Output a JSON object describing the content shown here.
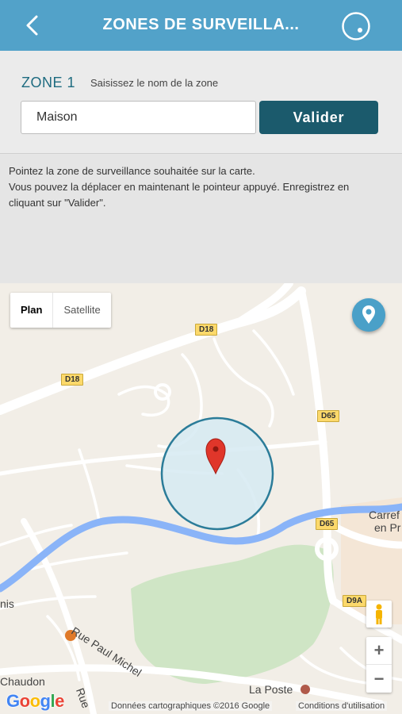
{
  "header": {
    "title": "ZONES DE SURVEILLA...",
    "back_icon": "chevron-left-icon",
    "target_icon": "target-icon"
  },
  "form": {
    "zone_label": "ZONE 1",
    "zone_hint": "Saisissez le nom de la zone",
    "zone_name_value": "Maison",
    "validate_label": "Valider"
  },
  "instructions": {
    "text_line1": "Pointez la zone de surveillance souhaitée sur la carte.",
    "text_line2": "Vous pouvez la déplacer en maintenant le pointeur appuyé. Enregistrez en cliquant sur \"Valider\"."
  },
  "map": {
    "map_types": {
      "plan": "Plan",
      "satellite": "Satellite"
    },
    "road_badges": {
      "d18_a": "D18",
      "d18_b": "D18",
      "d65_a": "D65",
      "d65_b": "D65",
      "d9a": "D9A"
    },
    "labels": {
      "rue_paul_michel": "Rue Paul Michel",
      "chaudon": "Chaudon",
      "la_poste": "La Poste",
      "carrefour_1": "Carref",
      "carrefour_2": "en Pr",
      "nis": "nis",
      "rue_cut": "Rue"
    },
    "google_logo": "Google",
    "attribution": "Données cartographiques ©2016 Google",
    "terms": "Conditions d'utilisation",
    "zoom_in": "+",
    "zoom_out": "−",
    "colors": {
      "river": "#8ab4f8",
      "zone_fill": "#d6eaf2",
      "zone_stroke": "#2b7c99",
      "pin": "#e0362a",
      "park": "#cfe5c5"
    }
  }
}
